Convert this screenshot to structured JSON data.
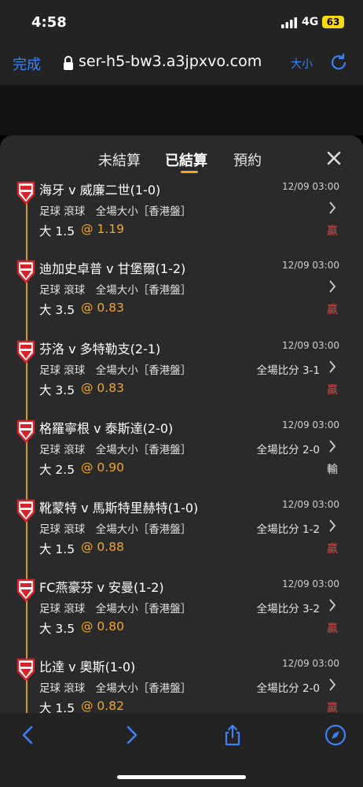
{
  "status_bar": {
    "time": "4:58",
    "network": "4G",
    "battery": "63"
  },
  "browser": {
    "done_label": "完成",
    "url": "ser-h5-bw3.a3jpxvo.com",
    "text_size_label": "大小"
  },
  "sheet": {
    "tabs": [
      {
        "label": "未結算",
        "active": false
      },
      {
        "label": "已結算",
        "active": true
      },
      {
        "label": "預約",
        "active": false
      }
    ]
  },
  "bets": [
    {
      "match": "海牙 v 威廉二世(1-0)",
      "date": "12/09 03:00",
      "market": "足球 滾球　全場大小［香港盤］",
      "score": "",
      "selection": "大 1.5",
      "odds": "@ 1.19",
      "result": "贏",
      "result_type": "win"
    },
    {
      "match": "迪加史卓普 v 甘堡爾(1-2)",
      "date": "12/09 03:00",
      "market": "足球 滾球　全場大小［香港盤］",
      "score": "",
      "selection": "大 3.5",
      "odds": "@ 0.83",
      "result": "贏",
      "result_type": "win"
    },
    {
      "match": "芬洛 v 多特勒支(2-1)",
      "date": "12/09 03:00",
      "market": "足球 滾球　全場大小［香港盤］",
      "score": "全場比分 3-1",
      "selection": "大 3.5",
      "odds": "@ 0.83",
      "result": "贏",
      "result_type": "win"
    },
    {
      "match": "格羅寧根 v 泰斯達(2-0)",
      "date": "12/09 03:00",
      "market": "足球 滾球　全場大小［香港盤］",
      "score": "全場比分 2-0",
      "selection": "大 2.5",
      "odds": "@ 0.90",
      "result": "輸",
      "result_type": "lose"
    },
    {
      "match": "靴蒙特 v 馬斯特里赫特(1-0)",
      "date": "12/09 03:00",
      "market": "足球 滾球　全場大小［香港盤］",
      "score": "全場比分 1-2",
      "selection": "大 1.5",
      "odds": "@ 0.88",
      "result": "贏",
      "result_type": "win"
    },
    {
      "match": "FC燕豪芬 v 安曼(1-2)",
      "date": "12/09 03:00",
      "market": "足球 滾球　全場大小［香港盤］",
      "score": "全場比分 3-2",
      "selection": "大 3.5",
      "odds": "@ 0.80",
      "result": "贏",
      "result_type": "win"
    },
    {
      "match": "比達 v 奧斯(1-0)",
      "date": "12/09 03:00",
      "market": "足球 滾球　全場大小［香港盤］",
      "score": "全場比分 2-0",
      "selection": "大 1.5",
      "odds": "@ 0.82",
      "result": "贏",
      "result_type": "win"
    }
  ],
  "colors": {
    "accent": "#f5a623",
    "win": "#e2453a",
    "link": "#3b82f6"
  }
}
